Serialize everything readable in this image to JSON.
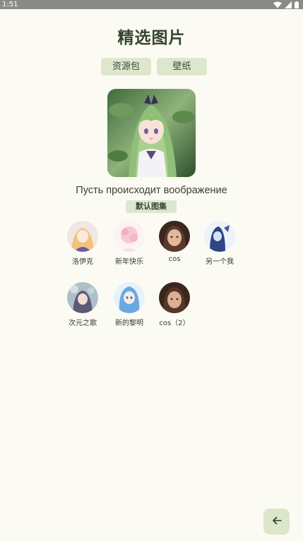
{
  "status_bar": {
    "time": "1:51",
    "icons": [
      "wifi-icon",
      "signal-icon",
      "battery-icon"
    ]
  },
  "page": {
    "title": "精选图片"
  },
  "tabs": [
    {
      "label": "资源包"
    },
    {
      "label": "壁纸"
    }
  ],
  "hero": {
    "caption": "Пусть происходит воображение",
    "album_label": "默认图集"
  },
  "avatars": [
    {
      "label": "洛伊克",
      "colors": [
        "#f2d29a",
        "#6b5aa8"
      ]
    },
    {
      "label": "新年快乐",
      "colors": [
        "#f8d5da",
        "#f3a9b6"
      ]
    },
    {
      "label": "cos",
      "colors": [
        "#4a3126",
        "#c99a7e"
      ]
    },
    {
      "label": "另一个我",
      "colors": [
        "#e9eef8",
        "#2e4a8a"
      ]
    },
    {
      "label": "次元之歌",
      "colors": [
        "#b7c7cf",
        "#6c6a8a"
      ]
    },
    {
      "label": "新的黎明",
      "colors": [
        "#cfe6f6",
        "#5b9bd6"
      ]
    },
    {
      "label": "cos（2）",
      "colors": [
        "#3f2a22",
        "#b8876c"
      ]
    }
  ],
  "back_button": {
    "icon": "arrow-left-icon"
  },
  "colors": {
    "background": "#fcfbf3",
    "chip": "#dde7cd",
    "title": "#344531"
  }
}
